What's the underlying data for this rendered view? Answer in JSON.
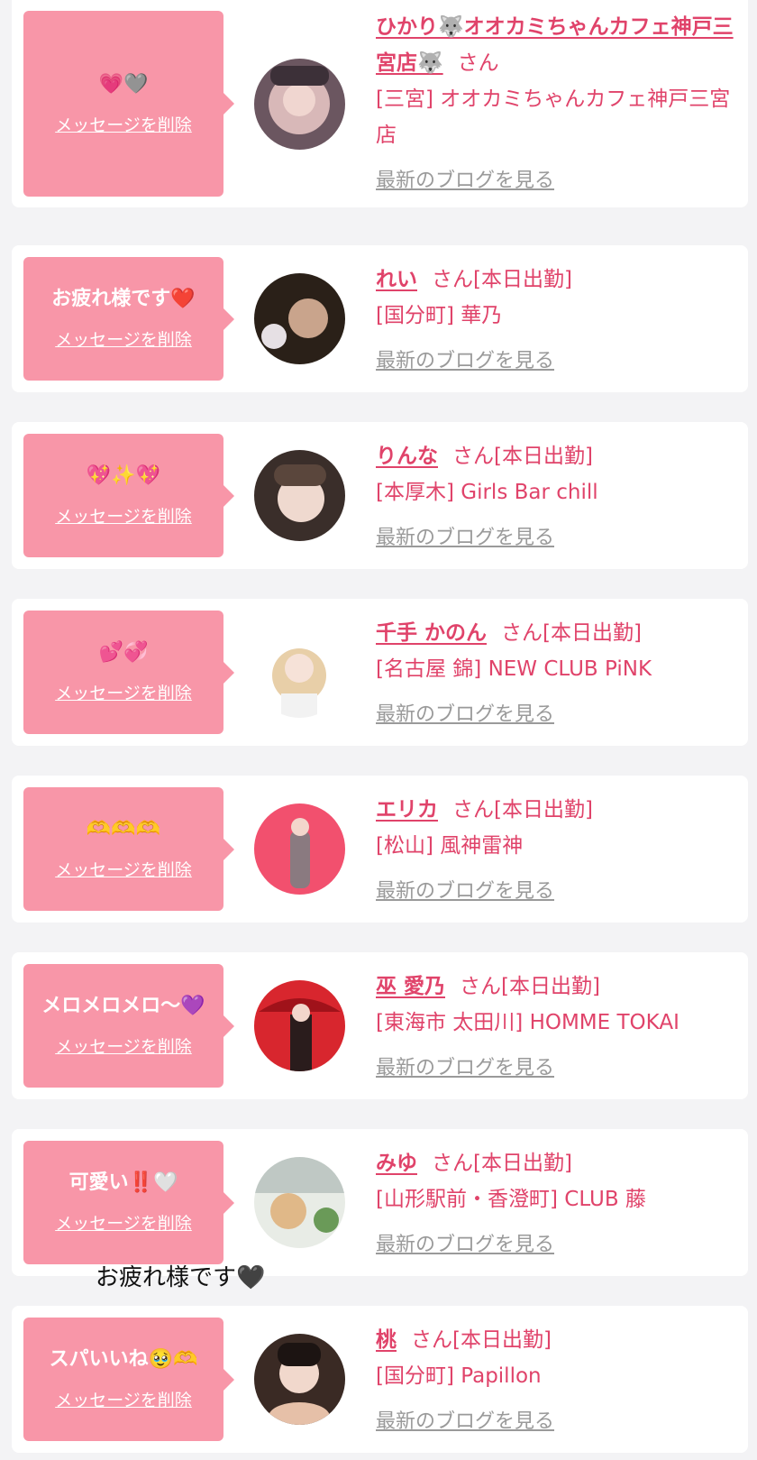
{
  "delete_label": "メッセージを削除",
  "blog_label": "最新のブログを見る",
  "san_label": "さん",
  "items": [
    {
      "message": "💗🩶",
      "name": "ひかり🐺オオカミちゃんカフェ神戸三宮店🐺",
      "status": "",
      "place": "[三宮] オオカミちゃんカフェ神戸三宮店"
    },
    {
      "message": "お疲れ様です❤️",
      "name": "れい",
      "status": "[本日出勤]",
      "place": "[国分町] 華乃"
    },
    {
      "message": "💖✨💖",
      "name": "りんな",
      "status": "[本日出勤]",
      "place": "[本厚木] Girls Bar chill"
    },
    {
      "message": "💕💞",
      "name": "千手 かのん",
      "status": "[本日出勤]",
      "place": "[名古屋 錦] NEW CLUB PiNK"
    },
    {
      "message": "🫶🫶🫶",
      "name": "エリカ",
      "status": "[本日出勤]",
      "place": "[松山] 風神雷神"
    },
    {
      "message": "メロメロメロ〜💜",
      "name": "巫 愛乃",
      "status": "[本日出勤]",
      "place": "[東海市 太田川] HOMME TOKAI"
    },
    {
      "message": "可愛い‼️🤍",
      "name": "みゆ",
      "status": "[本日出勤]",
      "place": "[山形駅前・香澄町] CLUB 藤"
    },
    {
      "message": "スパいいね🥹🫶",
      "name": "桃",
      "status": "[本日出勤]",
      "place": "[国分町] Papillon"
    }
  ],
  "overlay_text": "お疲れ様です🖤",
  "colors": {
    "bubble": "#f896a8",
    "accent": "#e0436a",
    "link_gray": "#9a9a9a",
    "background": "#f3f3f5"
  }
}
